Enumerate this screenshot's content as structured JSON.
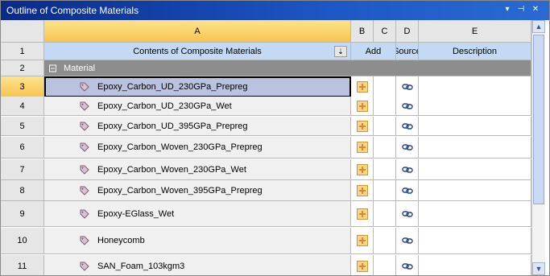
{
  "window": {
    "title": "Outline of Composite Materials"
  },
  "columns": [
    "A",
    "B",
    "C",
    "D",
    "E"
  ],
  "header_row": {
    "row": "1",
    "content_label": "Contents of Composite Materials",
    "add_label": "Add",
    "source_label": "Source",
    "description_label": "Description"
  },
  "group": {
    "row": "2",
    "label": "Material"
  },
  "materials": [
    {
      "row": "3",
      "name": "Epoxy_Carbon_UD_230GPa_Prepreg"
    },
    {
      "row": "4",
      "name": "Epoxy_Carbon_UD_230GPa_Wet"
    },
    {
      "row": "5",
      "name": "Epoxy_Carbon_UD_395GPa_Prepreg"
    },
    {
      "row": "6",
      "name": "Epoxy_Carbon_Woven_230GPa_Prepreg"
    },
    {
      "row": "7",
      "name": "Epoxy_Carbon_Woven_230GPa_Wet"
    },
    {
      "row": "8",
      "name": "Epoxy_Carbon_Woven_395GPa_Prepreg"
    },
    {
      "row": "9",
      "name": "Epoxy-EGlass_Wet"
    },
    {
      "row": "10",
      "name": "Honeycomb"
    },
    {
      "row": "11",
      "name": "SAN_Foam_103kgm3"
    }
  ],
  "selected_row": 0,
  "icons": {
    "title_menu": "chevron-down-icon",
    "title_pin": "pin-icon",
    "title_close": "close-icon",
    "sort": "sort-icon",
    "material": "material-tag-icon",
    "add": "add-plus-icon",
    "source": "link-icon"
  }
}
